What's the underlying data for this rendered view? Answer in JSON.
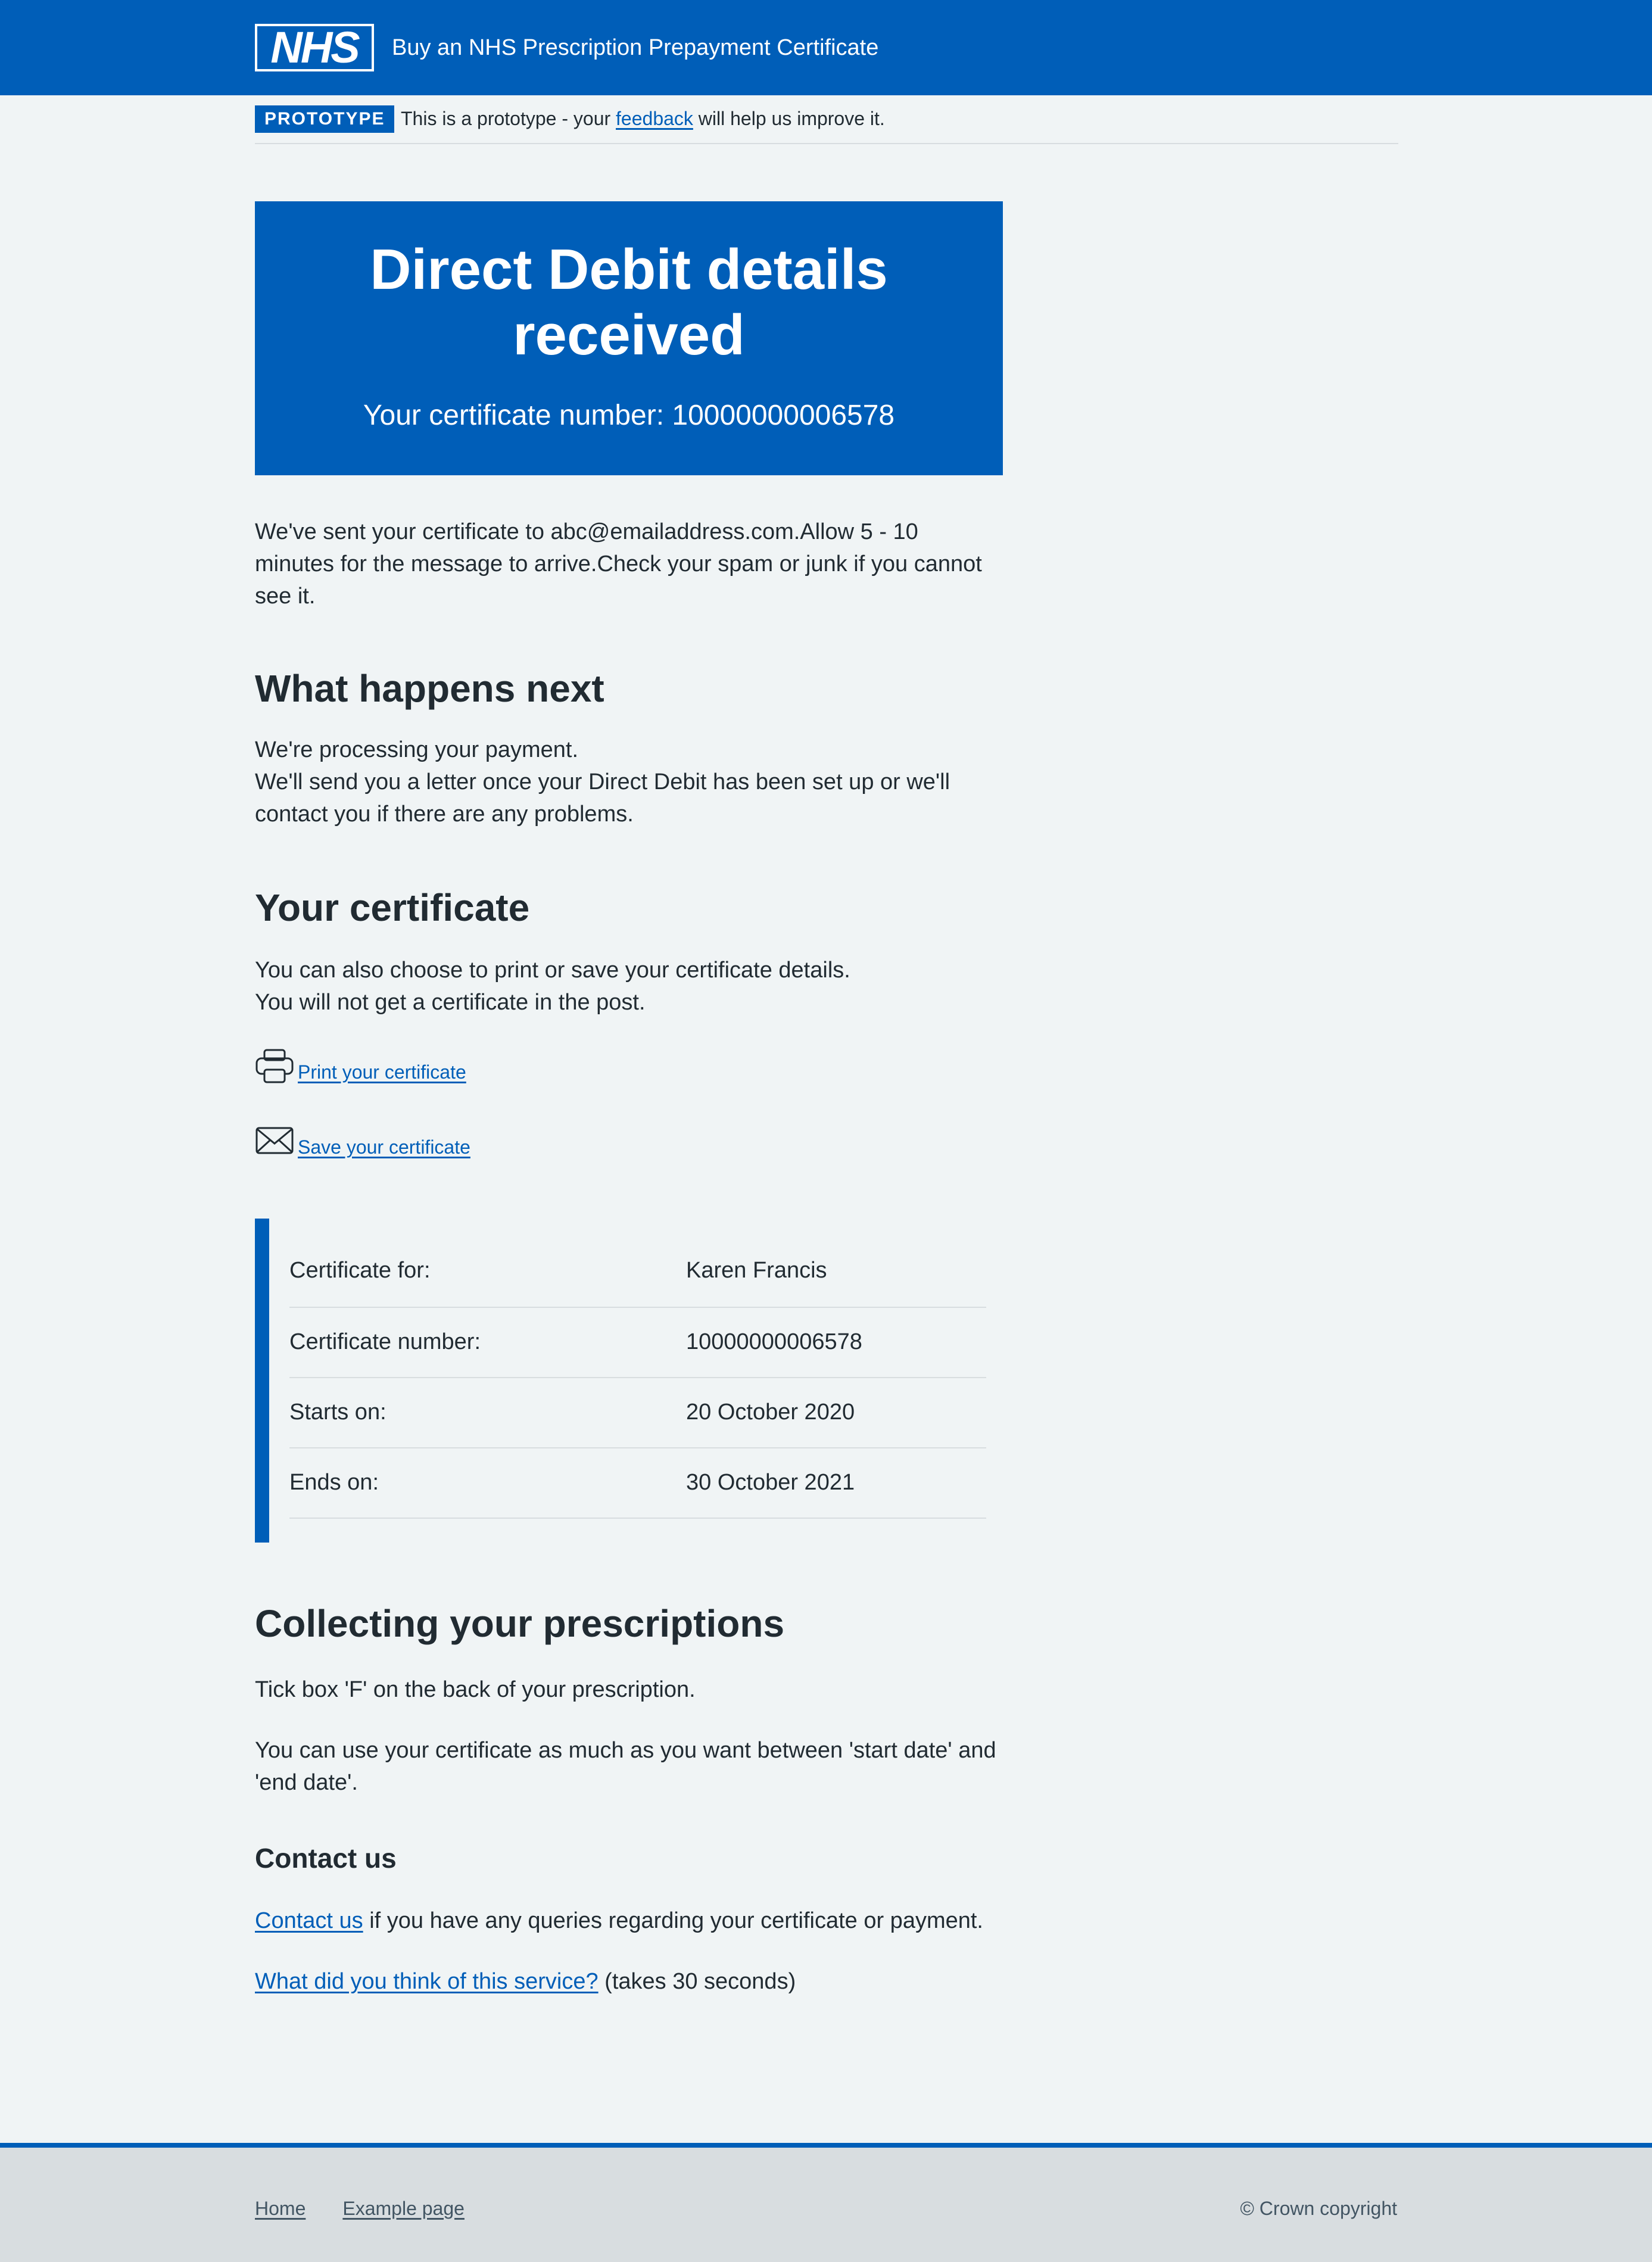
{
  "header": {
    "logo_text": "NHS",
    "service_name": "Buy an NHS Prescription Prepayment Certificate"
  },
  "phase_banner": {
    "tag": "PROTOTYPE",
    "text_before": "This is a prototype - your",
    "link": "feedback",
    "text_after": "will help us improve it."
  },
  "confirmation": {
    "title": "Direct Debit details received",
    "certificate_number_text": "Your certificate number: 10000000006578"
  },
  "intro": "We've sent your certificate to abc@emailaddress.com.Allow 5 - 10 minutes for the message to arrive.Check your spam or junk if you cannot see it.",
  "what_next": {
    "heading": "What happens next",
    "line1": "We're processing your payment.",
    "line2": "We'll send you a letter once your Direct Debit has been set up or we'll contact you if there are any problems."
  },
  "your_certificate": {
    "heading": "Your certificate",
    "line1": "You can also choose to print or save your certificate details.",
    "line2": "You will not get a certificate in the post.",
    "print_link": "Print your certificate",
    "save_link": "Save your certificate",
    "print_icon": "printer-icon",
    "save_icon": "envelope-icon"
  },
  "summary": [
    {
      "key": "Certificate for:",
      "value": "Karen Francis"
    },
    {
      "key": "Certificate number:",
      "value": "10000000006578"
    },
    {
      "key": "Starts on:",
      "value": "20 October 2020"
    },
    {
      "key": "Ends on:",
      "value": "30 October 2021"
    }
  ],
  "collecting": {
    "heading": "Collecting your prescriptions",
    "line1": "Tick box 'F' on the back of your prescription.",
    "line2": "You can use your certificate as much as you want between 'start date' and 'end date'."
  },
  "contact": {
    "heading": "Contact us",
    "link": "Contact us",
    "text": "if you have any queries regarding your certificate or payment.",
    "feedback_link": "What did you think of this service?",
    "feedback_note": "(takes 30 seconds)"
  },
  "footer": {
    "links": [
      "Home",
      "Example page"
    ],
    "copyright": "© Crown copyright"
  },
  "colors": {
    "nhs_blue": "#005eb8",
    "background": "#f0f4f5",
    "text": "#212b32",
    "footer_bg": "#d8dde0",
    "footer_text": "#425563"
  }
}
